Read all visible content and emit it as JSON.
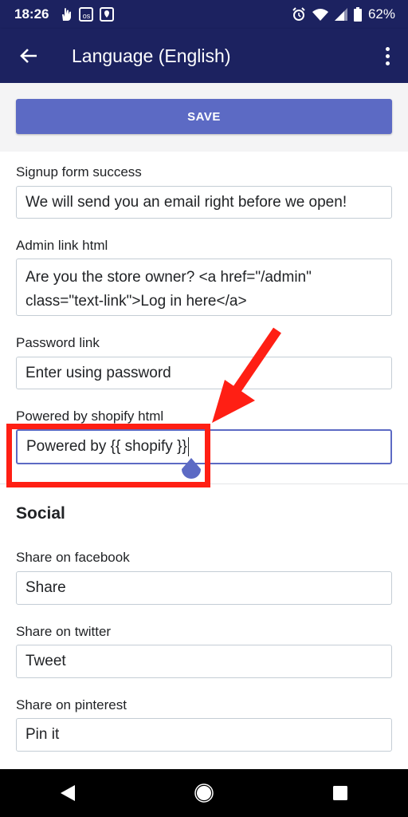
{
  "status": {
    "time": "18:26",
    "battery": "62%",
    "notif_icons": [
      "hand-icon",
      "os-icon",
      "location-icon"
    ]
  },
  "appbar": {
    "title": "Language (English)"
  },
  "save_label": "SAVE",
  "fields": [
    {
      "label": "Signup form success",
      "value": "We will send you an email right before we open!"
    },
    {
      "label": "Admin link html",
      "value_line1": "Are you the store owner? <a href=\"/admin\"",
      "value_line2": "class=\"text-link\">Log in here</a>"
    },
    {
      "label": "Password link",
      "value": "Enter using password"
    },
    {
      "label": "Powered by shopify html",
      "value": "Powered by {{ shopify }}"
    }
  ],
  "social": {
    "title": "Social",
    "fields": [
      {
        "label": "Share on facebook",
        "value": "Share"
      },
      {
        "label": "Share on twitter",
        "value": "Tweet"
      },
      {
        "label": "Share on pinterest",
        "value": "Pin it"
      }
    ]
  },
  "colors": {
    "appbar": "#1c2260",
    "accent": "#5c6ac4",
    "annotation": "#ff1f14"
  }
}
